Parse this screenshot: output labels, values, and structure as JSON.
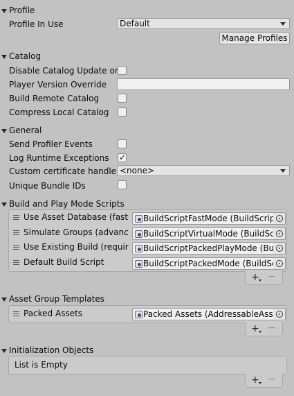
{
  "profile": {
    "title": "Profile",
    "profile_in_use_label": "Profile In Use",
    "profile_in_use_value": "Default",
    "manage_profiles_button": "Manage Profiles"
  },
  "catalog": {
    "title": "Catalog",
    "disable_update_label": "Disable Catalog Update on",
    "disable_update_checked": false,
    "player_version_label": "Player Version Override",
    "player_version_value": "",
    "build_remote_label": "Build Remote Catalog",
    "build_remote_checked": false,
    "compress_local_label": "Compress Local Catalog",
    "compress_local_checked": false
  },
  "general": {
    "title": "General",
    "send_profiler_label": "Send Profiler Events",
    "send_profiler_checked": false,
    "log_runtime_label": "Log Runtime Exceptions",
    "log_runtime_checked": true,
    "log_runtime_checkmark": "✓",
    "cert_handler_label": "Custom certificate handler",
    "cert_handler_value": "<none>",
    "unique_bundle_label": "Unique Bundle IDs",
    "unique_bundle_checked": false
  },
  "build_play_scripts": {
    "title": "Build and Play Mode Scripts",
    "items": [
      {
        "label": "Use Asset Database (faster)",
        "value": "BuildScriptFastMode (BuildScriptF"
      },
      {
        "label": "Simulate Groups (advanced)",
        "value": "BuildScriptVirtualMode (BuildScrip"
      },
      {
        "label": "Use Existing Build (requires",
        "value": "BuildScriptPackedPlayMode (Buil"
      },
      {
        "label": "Default Build Script",
        "value": "BuildScriptPackedMode (BuildScr"
      }
    ],
    "add_symbol": "+",
    "remove_symbol": "−"
  },
  "asset_group_templates": {
    "title": "Asset Group Templates",
    "items": [
      {
        "label": "Packed Assets",
        "value": "Packed Assets (AddressableAsset"
      }
    ],
    "add_symbol": "+",
    "remove_symbol": "−"
  },
  "initialization_objects": {
    "title": "Initialization Objects",
    "empty_text": "List is Empty",
    "add_symbol": "+",
    "remove_symbol": "−"
  }
}
